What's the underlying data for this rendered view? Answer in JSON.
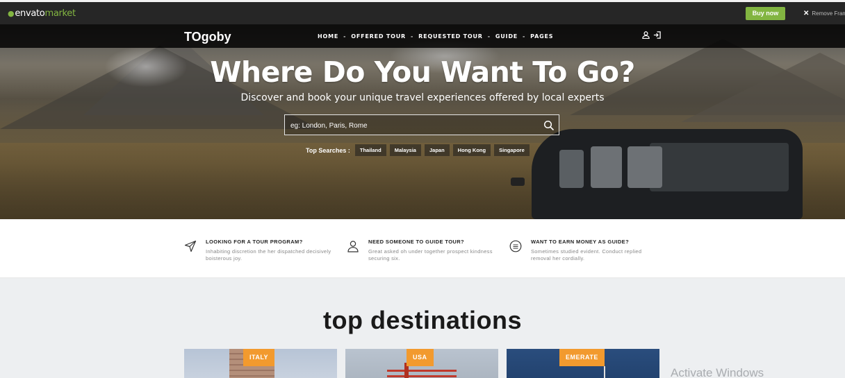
{
  "envato": {
    "logo_word1": "envato",
    "logo_word2": "market",
    "buy_now_label": "Buy now",
    "remove_frame_label": "Remove Frame"
  },
  "nav": {
    "brand": "TOgoby",
    "menu": [
      "HOME",
      "OFFERED TOUR",
      "REQUESTED TOUR",
      "GUIDE",
      "PAGES"
    ],
    "separator": "-"
  },
  "hero": {
    "title": "Where Do You Want To Go?",
    "subtitle": "Discover and book your unique travel experiences offered by local experts",
    "search_placeholder": "eg: London, Paris, Rome",
    "top_searches_label": "Top Searches :",
    "top_searches": [
      "Thailand",
      "Malaysia",
      "Japan",
      "Hong Kong",
      "Singapore"
    ]
  },
  "features": [
    {
      "icon": "paper-plane-icon",
      "title": "LOOKING FOR A TOUR PROGRAM?",
      "desc": "Inhabiting discretion the her dispatched decisively boisterous joy."
    },
    {
      "icon": "user-icon",
      "title": "NEED SOMEONE TO GUIDE TOUR?",
      "desc": "Great asked oh under together prospect kindness securing six."
    },
    {
      "icon": "list-circle-icon",
      "title": "WANT TO EARN MONEY AS GUIDE?",
      "desc": "Sometimes studied evident. Conduct replied removal her cordially."
    }
  ],
  "destinations": {
    "title": "top destinations",
    "cards": [
      {
        "tag": "ITALY"
      },
      {
        "tag": "USA"
      },
      {
        "tag": "EMERATE"
      }
    ]
  },
  "os_watermark": "Activate Windows",
  "colors": {
    "accent_orange": "#f29a2e",
    "envato_green": "#82b541"
  }
}
